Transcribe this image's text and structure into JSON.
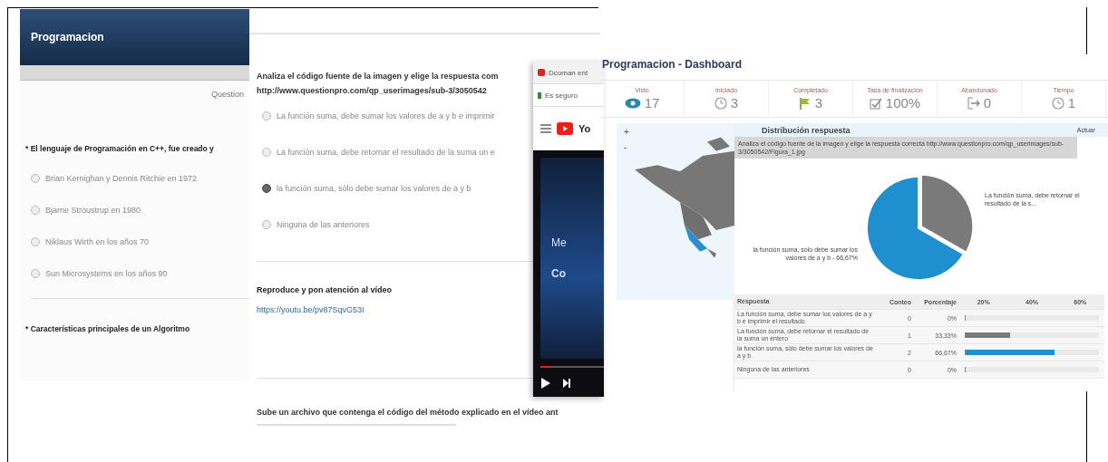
{
  "left_survey": {
    "title": "Programacion",
    "question_label": "Question",
    "questions": [
      {
        "text": "* El lenguaje de Programación en C++, fue creado y",
        "options": [
          {
            "label": "Brian Kernighan y Dennis Ritchie en 1972",
            "selected": false
          },
          {
            "label": "Bjarne Stroustrup en 1980",
            "selected": false
          },
          {
            "label": "Niklaus Wirth en los años 70",
            "selected": false
          },
          {
            "label": "Sun Microsystems en los años 90",
            "selected": false
          }
        ]
      },
      {
        "text": "* Características principales de un Algoritmo"
      }
    ]
  },
  "middle_survey": {
    "question": "Analiza el código fuente de la imagen y elige la respuesta com",
    "image_url": "http://www.questionpro.com/qp_userimages/sub-3/3050542",
    "options": [
      {
        "label": "La función suma, debe sumar los valores de a y b e imprimir",
        "selected": false
      },
      {
        "label": "La función suma, debe retornar el resultado de la suma un e",
        "selected": false
      },
      {
        "label": "la función suma, sólo debe sumar los valores de a y b",
        "selected": true
      },
      {
        "label": "Ninguna de las anteriores",
        "selected": false
      }
    ],
    "video_prompt": "Reproduce y pon atención al vídeo",
    "video_link": "https://youtu.be/pv87SqvG53I",
    "upload_prompt": "Sube un archivo que contenga el código del método explicado en el vídeo ant"
  },
  "popup": {
    "tab_title": "Dcoman ent",
    "address": "Es seguro",
    "logo_text": "Yo",
    "video_title": "Me",
    "video_subtitle": "Co"
  },
  "dashboard": {
    "title": "Programacion - Dashboard",
    "stats": [
      {
        "label": "Visto",
        "value": "17",
        "kind": "eye"
      },
      {
        "label": "Iniciado",
        "value": "3",
        "kind": "clock"
      },
      {
        "label": "Completado",
        "value": "3",
        "kind": "flag"
      },
      {
        "label": "Tasa de finalización",
        "value": "100%",
        "kind": "check"
      },
      {
        "label": "Abandonado",
        "value": "0",
        "kind": "exit"
      },
      {
        "label": "Tiempo",
        "value": "1",
        "kind": "clock"
      }
    ],
    "map_controls": [
      "+",
      "-"
    ],
    "panel_title": "Distribución respuesta",
    "panel_action": "Actuar",
    "panel_subtitle": "Analiza el código fuente de la imagen y elige la respuesta correcta http://www.questionpro.com/qp_userimages/sub-3/3050542/Figura_1.jpg",
    "pie_labels": [
      "La función suma, debe retornar el resultado de la s...",
      "la función suma, sólo debe sumar los valores de a y b - 66,67%"
    ],
    "table": {
      "columns": [
        "Respuesta",
        "Conteo",
        "Porcentaje",
        "20%",
        "40%",
        "60%"
      ],
      "rows": [
        {
          "answer": "La función suma, debe sumar los valores de a y b e imprimir el resultado",
          "count": "0",
          "percent": "0%"
        },
        {
          "answer": "La función suma, debe retornar el resultado de la suma un entero",
          "count": "1",
          "percent": "33,33%",
          "level": 0.33,
          "color": "#7a7a7a"
        },
        {
          "answer": "la función suma, sólo debe sumar los valores de a y b",
          "count": "2",
          "percent": "66,67%",
          "level": 0.67,
          "color": "#1f8fcf"
        },
        {
          "answer": "Ninguna de las anteriores",
          "count": "0",
          "percent": "0%"
        }
      ]
    }
  }
}
